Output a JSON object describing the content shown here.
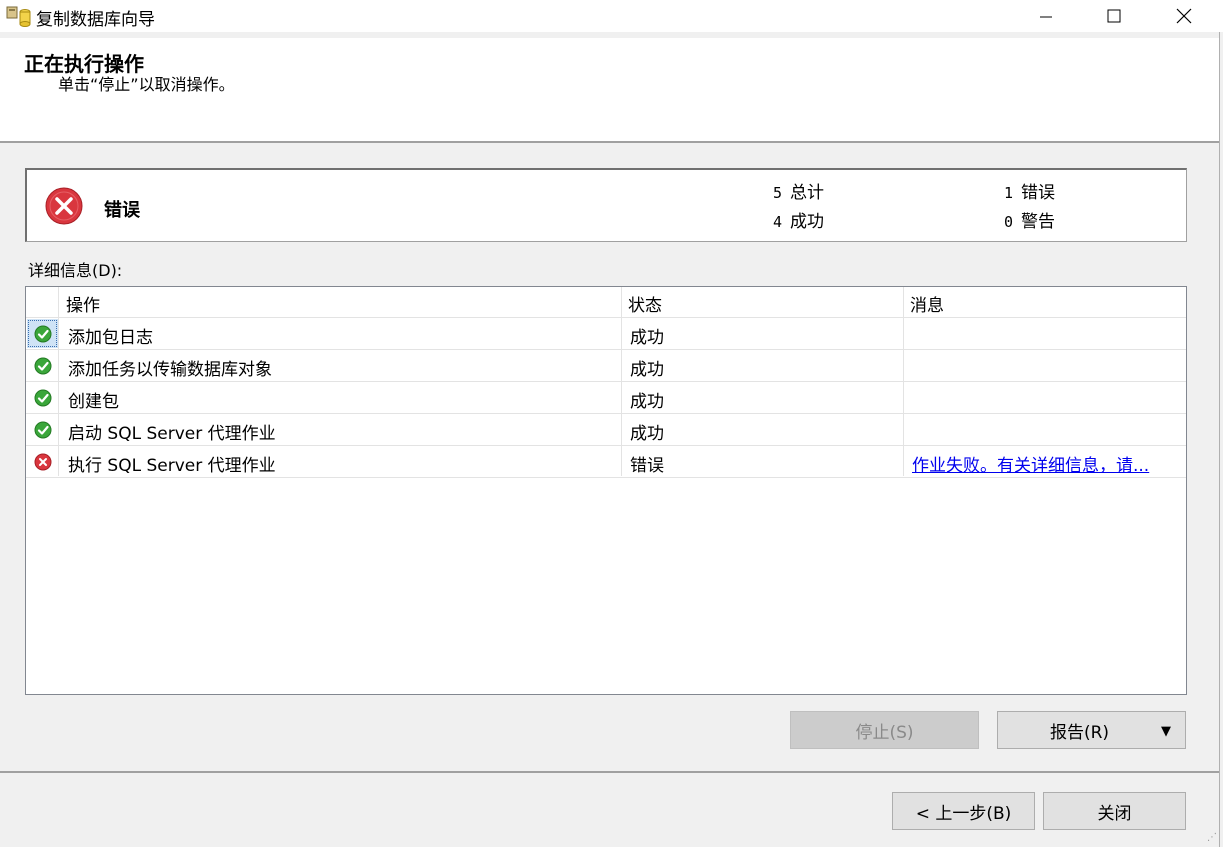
{
  "window": {
    "title": "复制数据库向导",
    "minimize": "—",
    "maximize": "☐",
    "close": "✕"
  },
  "header": {
    "title": "正在执行操作",
    "subtitle": "单击“停止”以取消操作。"
  },
  "summary": {
    "status": "错误",
    "total_num": "5",
    "total_label": "总计",
    "success_num": "4",
    "success_label": "成功",
    "error_num": "1",
    "error_label": "错误",
    "warning_num": "0",
    "warning_label": "警告"
  },
  "details": {
    "label": "详细信息(D):",
    "columns": [
      "操作",
      "状态",
      "消息"
    ],
    "rows": [
      {
        "status_icon": "success-icon",
        "action": "添加包日志",
        "status": "成功",
        "message": ""
      },
      {
        "status_icon": "success-icon",
        "action": "添加任务以传输数据库对象",
        "status": "成功",
        "message": ""
      },
      {
        "status_icon": "success-icon",
        "action": "创建包",
        "status": "成功",
        "message": ""
      },
      {
        "status_icon": "success-icon",
        "action": "启动 SQL Server 代理作业",
        "status": "成功",
        "message": ""
      },
      {
        "status_icon": "error-icon",
        "action": "执行 SQL Server 代理作业",
        "status": "错误",
        "message": "作业失败。有关详细信息，请..."
      }
    ]
  },
  "buttons": {
    "stop": "停止(S)",
    "report": "报告(R)",
    "report_arrow": "▼",
    "back": "< 上一步(B)",
    "close": "关闭"
  },
  "colors": {
    "success": "#3aa63a",
    "error": "#d9363e",
    "link": "#0000ee",
    "selection": "#cfe3f6"
  }
}
